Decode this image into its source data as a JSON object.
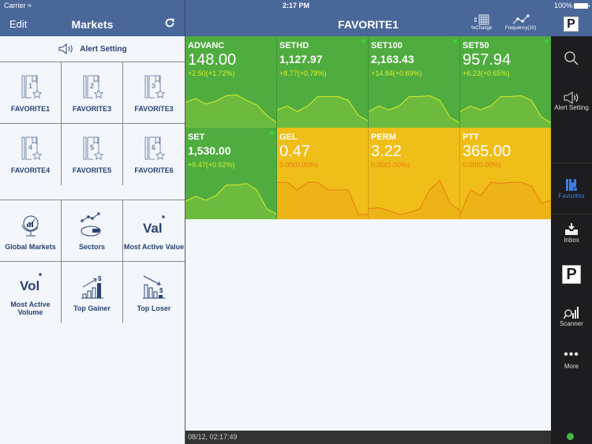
{
  "status_bar": {
    "carrier": "Carrier",
    "time": "2:17 PM",
    "battery": "100%"
  },
  "left_header": {
    "edit_label": "Edit",
    "title": "Markets",
    "refresh_icon": "refresh-icon"
  },
  "main_header": {
    "title": "FAVORITE1",
    "tools": [
      {
        "icon": "grid-icon",
        "label": "%Change"
      },
      {
        "icon": "line-chart-icon",
        "label": "Frequency(10)"
      }
    ],
    "logo_letter": "P"
  },
  "alert_setting": {
    "icon": "speaker-icon",
    "label": "Alert Setting"
  },
  "favorites": [
    {
      "number": "1",
      "label": "FAVORITE1"
    },
    {
      "number": "2",
      "label": "FAVORITE3"
    },
    {
      "number": "3",
      "label": "FAVORITE3"
    },
    {
      "number": "4",
      "label": "FAVORITE4"
    },
    {
      "number": "5",
      "label": "FAVORITE5"
    },
    {
      "number": "6",
      "label": "FAVORITE6"
    }
  ],
  "tools": [
    {
      "icon": "globe-chart-icon",
      "label": "Global Markets"
    },
    {
      "icon": "sectors-icon",
      "label": "Sectors"
    },
    {
      "icon": "most-active-value-icon",
      "label": "Most Active Value",
      "glyph": "Val"
    },
    {
      "icon": "most-active-volume-icon",
      "label": "Most Active Volume",
      "glyph": "Vol"
    },
    {
      "icon": "top-gainer-icon",
      "label": "Top Gainer"
    },
    {
      "icon": "top-loser-icon",
      "label": "Top Loser"
    }
  ],
  "tiles": [
    {
      "symbol": "ADVANC",
      "price": "148.00",
      "change": "+2.50(+1.72%)",
      "trend": "up",
      "bold_price": false,
      "dot": false,
      "spark": [
        0.55,
        0.65,
        0.5,
        0.58,
        0.72,
        0.75,
        0.6,
        0.48,
        0.2,
        0.0
      ]
    },
    {
      "symbol": "SETHD",
      "price": "1,127.97",
      "change": "+8.77(+0.78%)",
      "trend": "up",
      "bold_price": true,
      "dot": true,
      "spark": [
        0.35,
        0.45,
        0.3,
        0.45,
        0.7,
        0.7,
        0.7,
        0.6,
        0.2,
        0.05
      ]
    },
    {
      "symbol": "SET100",
      "price": "2,163.43",
      "change": "+14.84(+0.69%)",
      "trend": "up",
      "bold_price": true,
      "dot": true,
      "spark": [
        0.3,
        0.45,
        0.35,
        0.45,
        0.7,
        0.7,
        0.72,
        0.6,
        0.15,
        0.0
      ]
    },
    {
      "symbol": "SET50",
      "price": "957.94",
      "change": "+6.23(+0.65%)",
      "trend": "up",
      "bold_price": false,
      "dot": true,
      "spark": [
        0.3,
        0.45,
        0.35,
        0.45,
        0.7,
        0.7,
        0.72,
        0.6,
        0.15,
        0.0
      ]
    },
    {
      "symbol": "SET",
      "price": "1,530.00",
      "change": "+9.47(+0.62%)",
      "trend": "up",
      "bold_price": true,
      "dot": true,
      "spark": [
        0.35,
        0.48,
        0.38,
        0.5,
        0.78,
        0.78,
        0.82,
        0.65,
        0.15,
        0.0
      ]
    },
    {
      "symbol": "GEL",
      "price": "0.47",
      "change": "0.00(0.00%)",
      "trend": "flat",
      "bold_price": false,
      "dot": false,
      "spark": [
        0.85,
        0.85,
        0.65,
        0.85,
        0.85,
        0.65,
        0.65,
        0.65,
        0.0,
        0.0
      ]
    },
    {
      "symbol": "PERM",
      "price": "3.22",
      "change": "0.00(0.00%)",
      "trend": "flat",
      "bold_price": false,
      "dot": false,
      "spark": [
        0.15,
        0.18,
        0.1,
        0.0,
        0.05,
        0.15,
        0.65,
        0.9,
        0.3,
        0.1
      ]
    },
    {
      "symbol": "PTT",
      "price": "365.00",
      "change": "0.00(0.00%)",
      "trend": "flat",
      "bold_price": false,
      "dot": false,
      "spark": [
        0.0,
        0.65,
        0.5,
        0.85,
        0.82,
        0.85,
        0.85,
        0.75,
        0.3,
        0.38
      ]
    }
  ],
  "footer": {
    "timestamp": "08/12, 02:17:49"
  },
  "sidebar": [
    {
      "icon": "search-icon",
      "label": ""
    },
    {
      "icon": "speaker-icon",
      "label": "Alert Setting"
    },
    {
      "icon": "favorites-icon",
      "label": "Favorites",
      "active": true
    },
    {
      "icon": "inbox-icon",
      "label": "Inbox"
    },
    {
      "icon": "p-logo-icon",
      "label": ""
    },
    {
      "icon": "scanner-icon",
      "label": "Scanner"
    },
    {
      "icon": "more-icon",
      "label": "More"
    }
  ],
  "colors": {
    "header_blue": "#4a679a",
    "up_green": "#4fac3f",
    "flat_yellow": "#f0be18",
    "change_up": "#d9ef2c",
    "change_flat": "#e57d10",
    "active_blue": "#3d7de0",
    "connection_dot": "#44b942"
  }
}
